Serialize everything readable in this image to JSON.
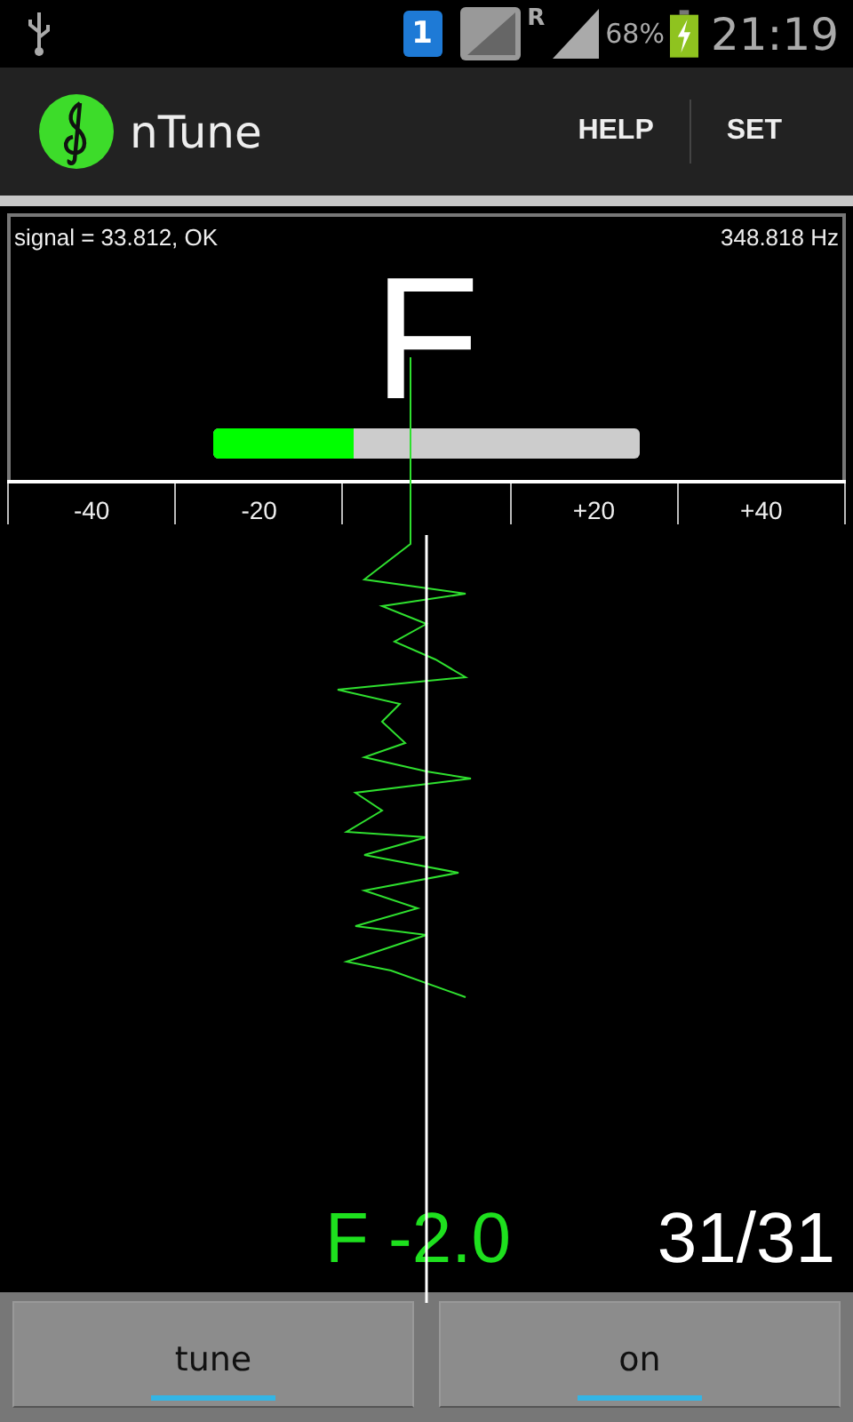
{
  "status_bar": {
    "sim": "1",
    "roaming": "R",
    "battery": "68%",
    "time": "21:19"
  },
  "action_bar": {
    "title": "nTune",
    "actions": [
      "HELP",
      "SET"
    ]
  },
  "panel": {
    "signal": "signal = 33.812, OK",
    "frequency": "348.818 Hz",
    "note": "F",
    "level": 0.33
  },
  "scale": [
    "-40",
    "-20",
    "+20",
    "+40"
  ],
  "readout": {
    "deviation": "F -2.0",
    "count": "31/31"
  },
  "buttons": [
    {
      "label": "tune",
      "lit": true
    },
    {
      "label": "on",
      "lit": true
    }
  ]
}
